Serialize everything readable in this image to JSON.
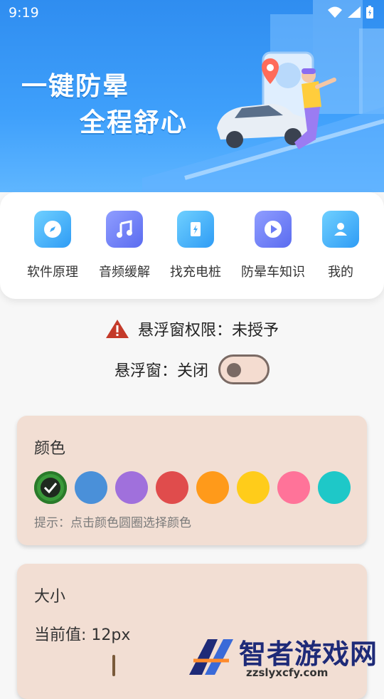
{
  "status_bar": {
    "time": "9:19"
  },
  "banner": {
    "slogan_line1": "一键防晕",
    "slogan_line2": "全程舒心"
  },
  "features": [
    {
      "label": "软件原理",
      "icon": "compass-icon",
      "color": "#3fa9f5"
    },
    {
      "label": "音频缓解",
      "icon": "music-note-icon",
      "color": "#6b7cf5"
    },
    {
      "label": "找充电桩",
      "icon": "charging-station-icon",
      "color": "#3fa9f5"
    },
    {
      "label": "防晕车知识",
      "icon": "play-icon",
      "color": "#6b7cf5"
    },
    {
      "label": "我的",
      "icon": "user-icon",
      "color": "#3fa9f5"
    }
  ],
  "permission": {
    "text": "悬浮窗权限：未授予"
  },
  "floating_window": {
    "label": "悬浮窗：关闭",
    "enabled": false
  },
  "color_card": {
    "title": "颜色",
    "hint": "提示：点击颜色圆圈选择颜色",
    "selected_index": 0,
    "swatches": [
      "#3a9a3a",
      "#4a90d9",
      "#a070dc",
      "#e04c4c",
      "#ff9a1a",
      "#ffcc1a",
      "#ff7399",
      "#1ec8c8"
    ]
  },
  "size_card": {
    "title": "大小",
    "current": "当前值: 12px"
  },
  "watermark": {
    "text": "智者游戏网",
    "url": "zzslyxcfy.com"
  }
}
